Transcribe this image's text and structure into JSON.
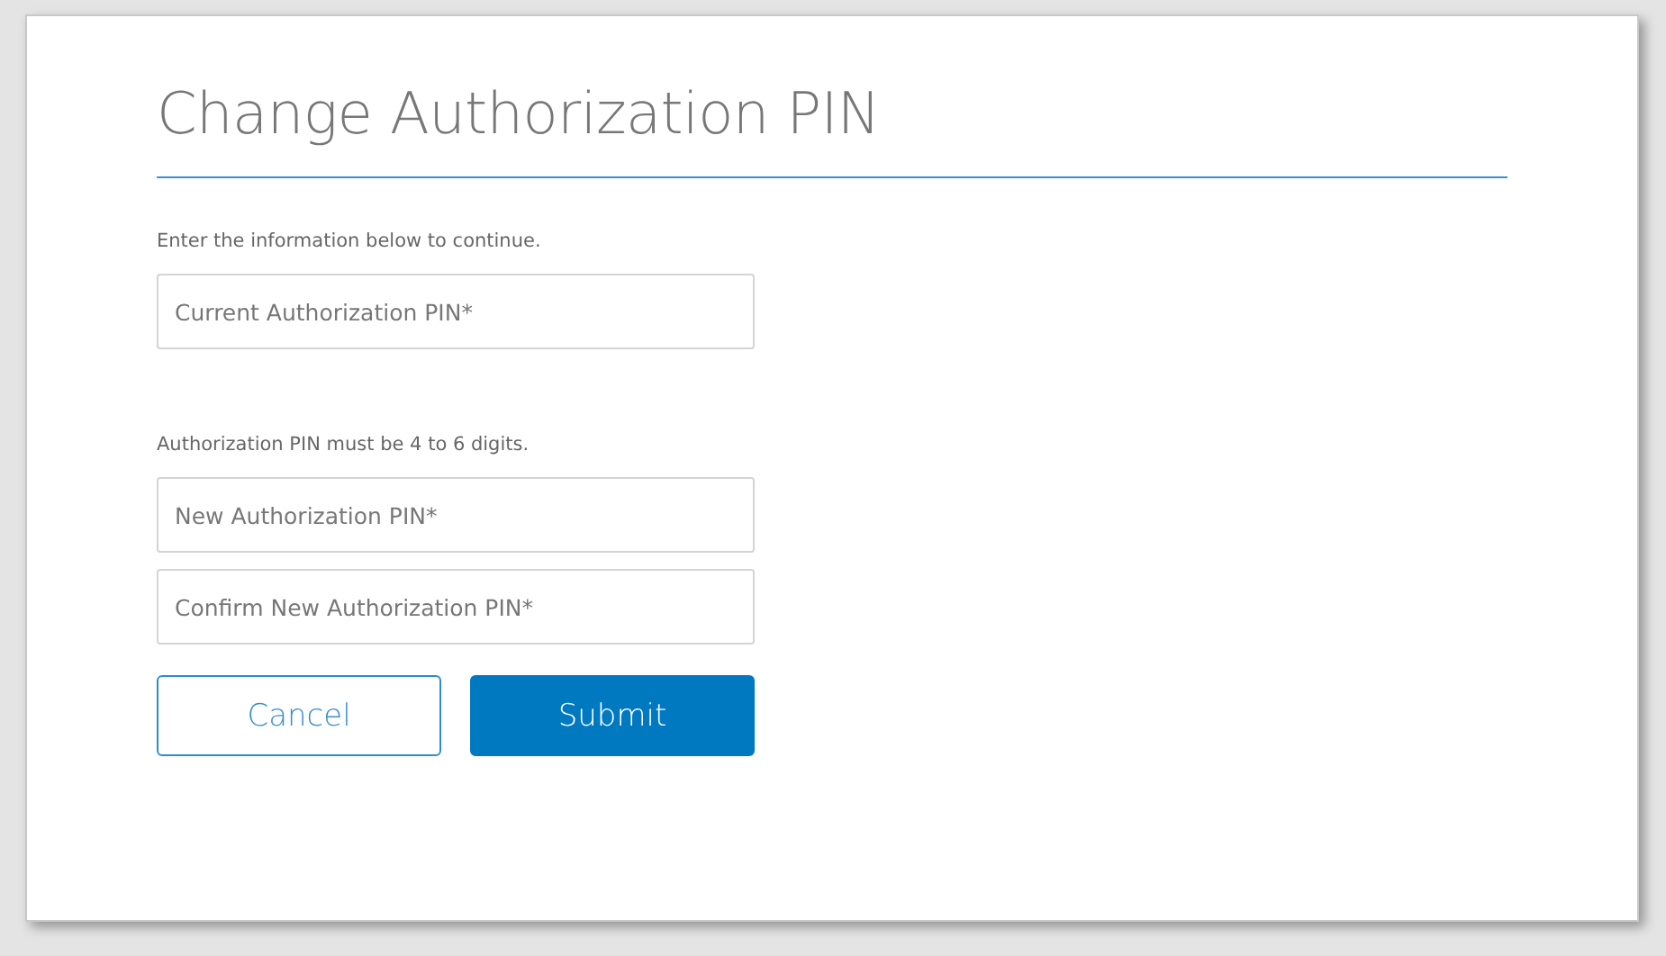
{
  "title": "Change Authorization PIN",
  "sections": [
    {
      "note": "Enter the information below to continue.",
      "fields": [
        {
          "placeholder": "Current Authorization PIN*"
        }
      ]
    },
    {
      "note": "Authorization PIN must be 4 to 6 digits.",
      "fields": [
        {
          "placeholder": "New Authorization PIN*"
        },
        {
          "placeholder": "Confirm New Authorization PIN*"
        }
      ]
    }
  ],
  "buttons": [
    {
      "label": "Cancel",
      "kind": "secondary"
    },
    {
      "label": "Submit",
      "kind": "primary"
    }
  ]
}
